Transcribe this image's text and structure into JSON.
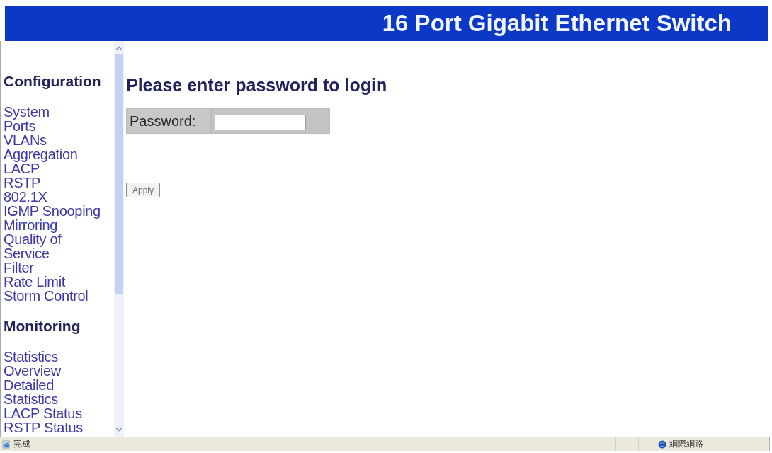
{
  "window": {
    "title": "16 Port Gigabit Ethernet Switch"
  },
  "sidebar": {
    "sections": [
      {
        "heading": "Configuration",
        "items": [
          "System",
          "Ports",
          "VLANs",
          "Aggregation",
          "LACP",
          "RSTP",
          "802.1X",
          "IGMP Snooping",
          "Mirroring",
          "Quality of Service",
          "Filter",
          "Rate Limit",
          "Storm Control"
        ]
      },
      {
        "heading": "Monitoring",
        "items": [
          "Statistics Overview",
          "Detailed Statistics",
          "LACP Status",
          "RSTP Status"
        ]
      }
    ]
  },
  "content": {
    "heading": "Please enter password to login",
    "password_field": {
      "label": "Password:"
    },
    "buttons": [
      "Apply"
    ]
  },
  "status_bar": {
    "status": "完成",
    "zone": "網際網路"
  }
}
